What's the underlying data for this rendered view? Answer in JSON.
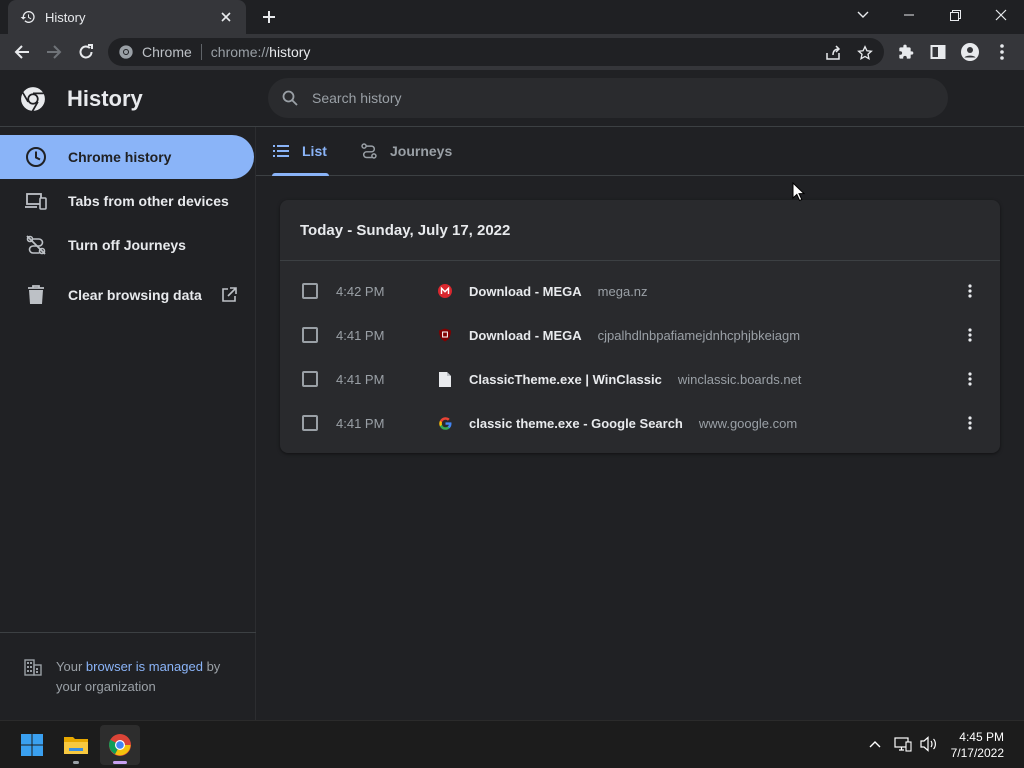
{
  "browser": {
    "tab_title": "History",
    "omnibox": {
      "site_label": "Chrome",
      "scheme": "chrome://",
      "host": "history"
    }
  },
  "page": {
    "title": "History",
    "search_placeholder": "Search history"
  },
  "sidebar": {
    "items": [
      {
        "label": "Chrome history"
      },
      {
        "label": "Tabs from other devices"
      },
      {
        "label": "Turn off Journeys"
      },
      {
        "label": "Clear browsing data"
      }
    ],
    "managed": {
      "prefix": "Your ",
      "link": "browser is managed",
      "suffix": " by your organization"
    }
  },
  "tabs": [
    {
      "label": "List"
    },
    {
      "label": "Journeys"
    }
  ],
  "history": {
    "date_header": "Today - Sunday, July 17, 2022",
    "rows": [
      {
        "time": "4:42 PM",
        "title": "Download - MEGA",
        "domain": "mega.nz",
        "favicon": "mega-icon"
      },
      {
        "time": "4:41 PM",
        "title": "Download - MEGA",
        "domain": "cjpalhdlnbpafiamejdnhcphjbkeiagm",
        "favicon": "ublock-icon"
      },
      {
        "time": "4:41 PM",
        "title": "ClassicTheme.exe | WinClassic",
        "domain": "winclassic.boards.net",
        "favicon": "document-icon"
      },
      {
        "time": "4:41 PM",
        "title": "classic theme.exe - Google Search",
        "domain": "www.google.com",
        "favicon": "google-icon"
      }
    ]
  },
  "taskbar": {
    "time": "4:45 PM",
    "date": "7/17/2022"
  },
  "colors": {
    "accent": "#8ab4f8",
    "background": "#202124",
    "card": "#292a2d"
  }
}
